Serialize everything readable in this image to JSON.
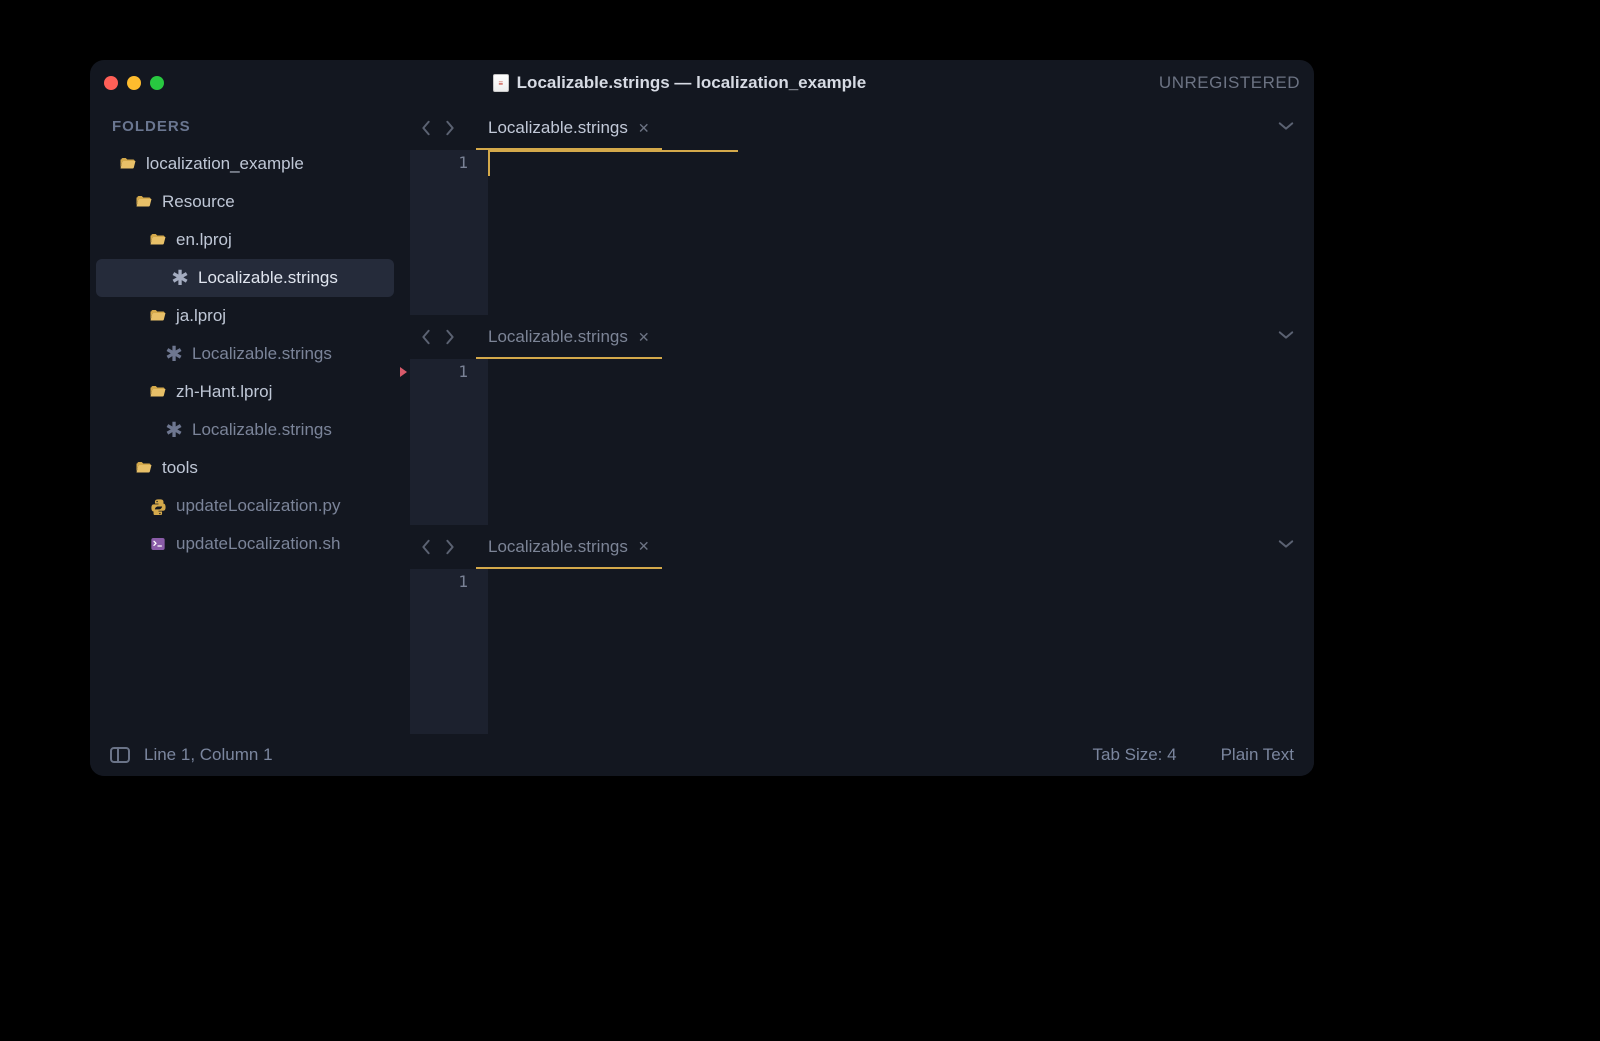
{
  "title": "Localizable.strings — localization_example",
  "unregistered": "UNREGISTERED",
  "sidebar": {
    "header": "FOLDERS",
    "items": [
      {
        "name": "localization_example",
        "type": "folder",
        "indent": 1
      },
      {
        "name": "Resource",
        "type": "folder",
        "indent": 2
      },
      {
        "name": "en.lproj",
        "type": "folder",
        "indent": 3
      },
      {
        "name": "Localizable.strings",
        "type": "strings",
        "indent": 4,
        "selected": true
      },
      {
        "name": "ja.lproj",
        "type": "folder",
        "indent": 3
      },
      {
        "name": "Localizable.strings",
        "type": "strings",
        "indent": 4,
        "dim": true
      },
      {
        "name": "zh-Hant.lproj",
        "type": "folder",
        "indent": 3
      },
      {
        "name": "Localizable.strings",
        "type": "strings",
        "indent": 4,
        "dim": true
      },
      {
        "name": "tools",
        "type": "folder",
        "indent": 2
      },
      {
        "name": "updateLocalization.py",
        "type": "python",
        "indent": 3,
        "dim": true
      },
      {
        "name": "updateLocalization.sh",
        "type": "shell",
        "indent": 3,
        "dim": true
      }
    ]
  },
  "panes": [
    {
      "tab": "Localizable.strings",
      "line_number": "1",
      "active": true
    },
    {
      "tab": "Localizable.strings",
      "line_number": "1",
      "bookmark": true
    },
    {
      "tab": "Localizable.strings",
      "line_number": "1"
    }
  ],
  "status": {
    "position": "Line 1, Column 1",
    "tab_size": "Tab Size: 4",
    "syntax": "Plain Text"
  }
}
